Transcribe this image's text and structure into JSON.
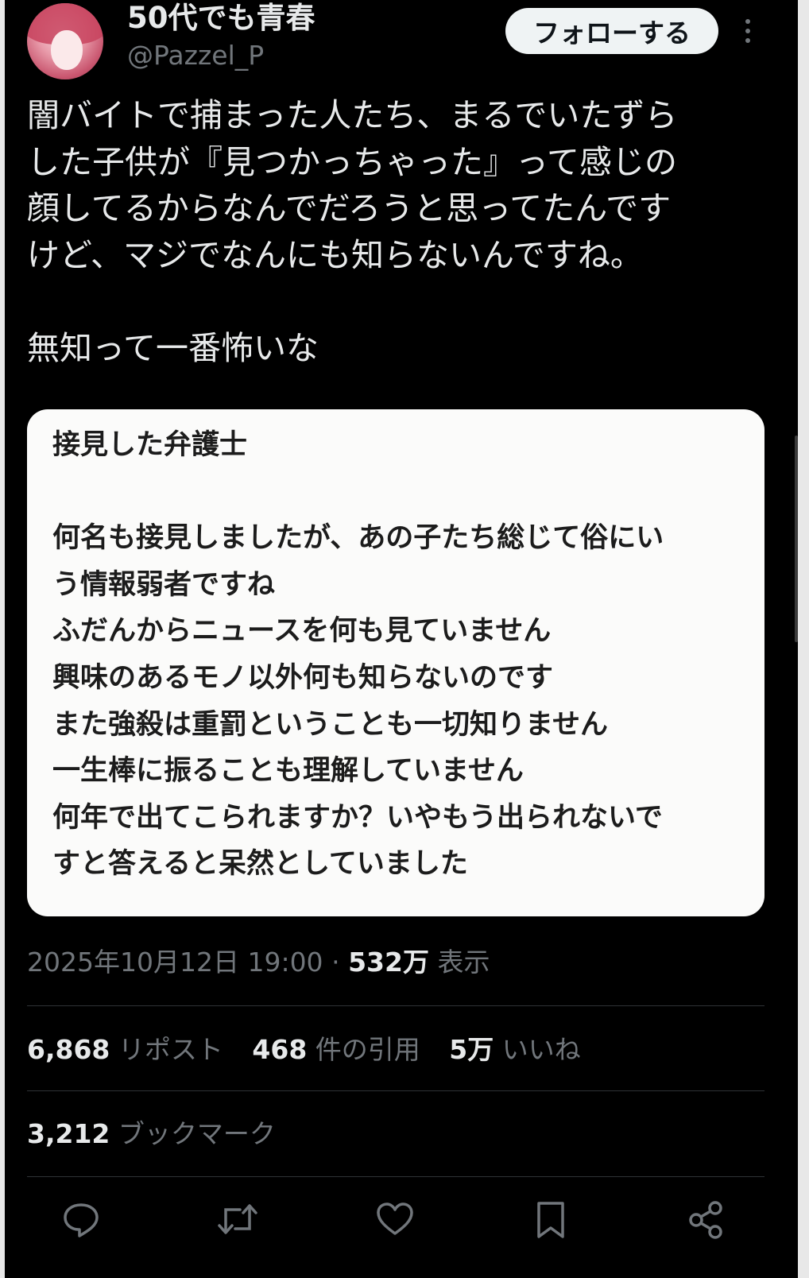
{
  "author": {
    "display_name": "50代でも青春",
    "handle": "@Pazzel_P",
    "follow_label": "フォローする"
  },
  "tweet": {
    "text": "闇バイトで捕まった人たち、まるでいたずら\nした子供が『見つかっちゃった』って感じの\n顔してるからなんでだろうと思ってたんです\nけど、マジでなんにも知らないんですね。\n\n無知って一番怖いな"
  },
  "quote_card": {
    "text": "接見した弁護士\n\n何名も接見しましたが、あの子たち総じて俗にい\nう情報弱者ですね\nふだんからニュースを何も見ていません\n興味のあるモノ以外何も知らないのです\nまた強殺は重罰ということも一切知りません\n一生棒に振ることも理解していません\n何年で出てこられますか？いやもう出られないで\nすと答えると呆然としていました"
  },
  "meta": {
    "timestamp": "2025年10月12日 19:00",
    "separator": "·",
    "views_count": "532万",
    "views_label": "表示"
  },
  "stats": {
    "reposts_count": "6,868",
    "reposts_label": "リポスト",
    "quotes_count": "468",
    "quotes_label": "件の引用",
    "likes_count": "5万",
    "likes_label": "いいね",
    "bookmarks_count": "3,212",
    "bookmarks_label": "ブックマーク"
  },
  "actions": {
    "icons": [
      "reply-icon",
      "repost-icon",
      "like-icon",
      "bookmark-icon",
      "share-icon"
    ]
  },
  "colors": {
    "background": "#000000",
    "text_primary": "#e7e9ea",
    "text_secondary": "#71767b",
    "divider": "#2f3336",
    "card_background": "#fbfbfa",
    "follow_button": "#eff3f4"
  }
}
